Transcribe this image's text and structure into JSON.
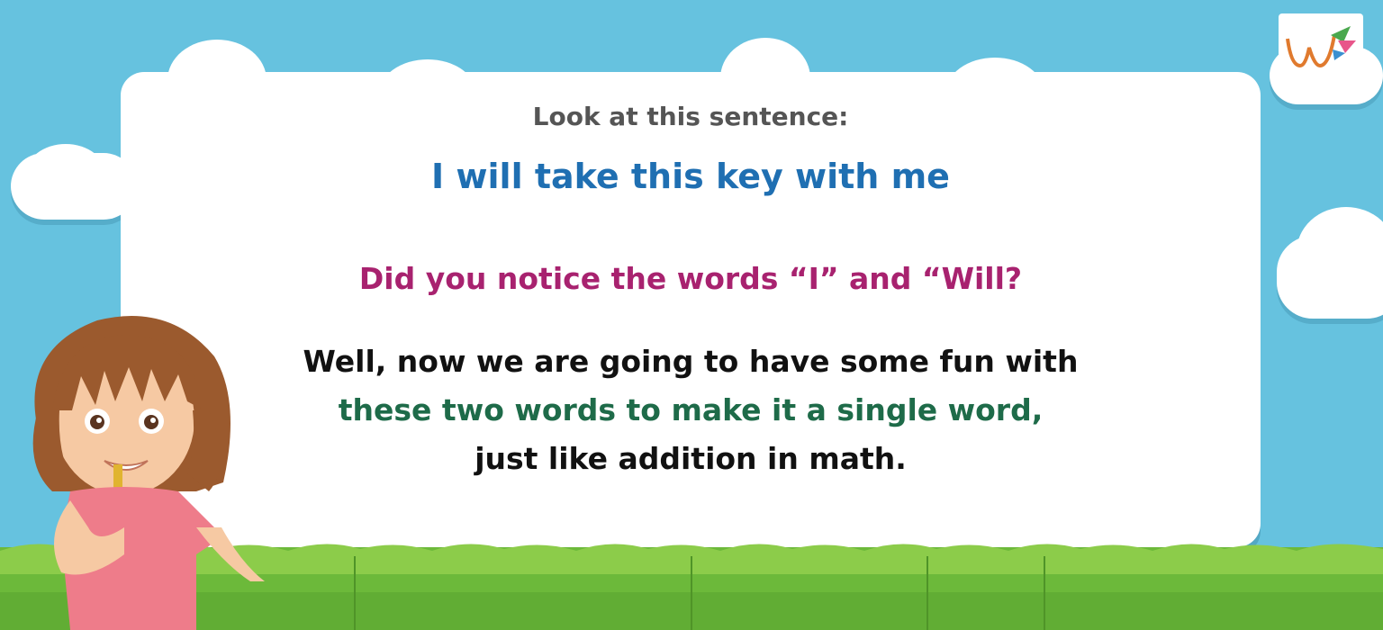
{
  "slide": {
    "line1": "Look at this sentence:",
    "line2": "I will take this key with me",
    "line3": "Did you notice the words “I” and “Will?",
    "line4a": "Well, now we are going to have some fun with",
    "line4b": "these two words to make it a single word,",
    "line4c": "just like addition in math."
  },
  "colors": {
    "sky": "#66c2df",
    "heading_gray": "#555555",
    "sentence_blue": "#1f6fb2",
    "question_magenta": "#a8226f",
    "body_black": "#111111",
    "body_green": "#1e6b49",
    "grass": "#6fbe3a"
  },
  "icons": {
    "logo": "logo-icon",
    "girl": "girl-with-key-illustration"
  }
}
